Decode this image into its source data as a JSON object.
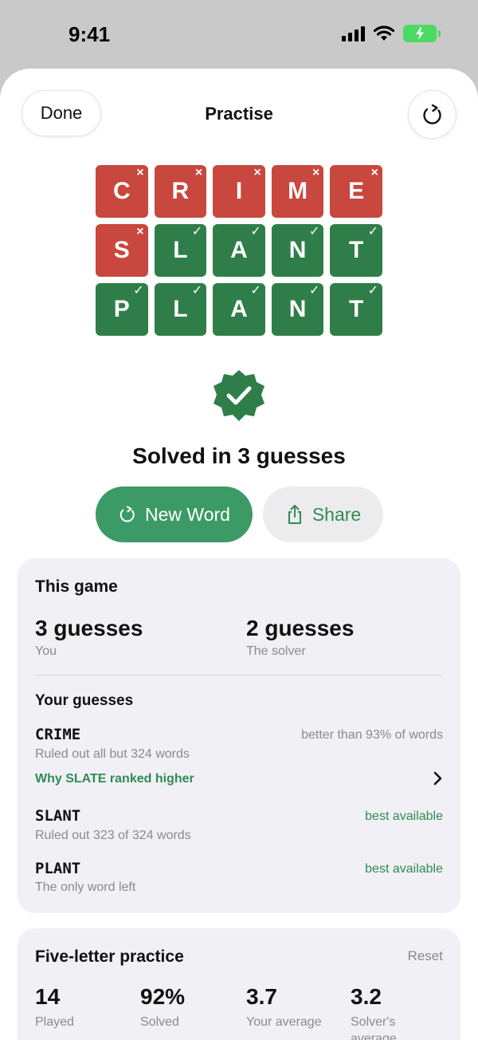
{
  "status_bar": {
    "time": "9:41"
  },
  "nav": {
    "done_label": "Done",
    "title": "Practise",
    "refresh_icon": "refresh-icon"
  },
  "colors": {
    "correct": "#2f7e49",
    "wrong": "#c8473f",
    "accent": "#3b9a66",
    "card_bg": "#f1f1f5"
  },
  "grid": [
    [
      {
        "letter": "C",
        "state": "wrong",
        "mark": "×"
      },
      {
        "letter": "R",
        "state": "wrong",
        "mark": "×"
      },
      {
        "letter": "I",
        "state": "wrong",
        "mark": "×"
      },
      {
        "letter": "M",
        "state": "wrong",
        "mark": "×"
      },
      {
        "letter": "E",
        "state": "wrong",
        "mark": "×"
      }
    ],
    [
      {
        "letter": "S",
        "state": "wrong",
        "mark": "×"
      },
      {
        "letter": "L",
        "state": "correct",
        "mark": "✓"
      },
      {
        "letter": "A",
        "state": "correct",
        "mark": "✓"
      },
      {
        "letter": "N",
        "state": "correct",
        "mark": "✓"
      },
      {
        "letter": "T",
        "state": "correct",
        "mark": "✓"
      }
    ],
    [
      {
        "letter": "P",
        "state": "correct",
        "mark": "✓"
      },
      {
        "letter": "L",
        "state": "correct",
        "mark": "✓"
      },
      {
        "letter": "A",
        "state": "correct",
        "mark": "✓"
      },
      {
        "letter": "N",
        "state": "correct",
        "mark": "✓"
      },
      {
        "letter": "T",
        "state": "correct",
        "mark": "✓"
      }
    ]
  ],
  "result": {
    "title": "Solved in 3 guesses"
  },
  "actions": {
    "new_word_label": "New Word",
    "share_label": "Share"
  },
  "this_game": {
    "heading": "This game",
    "you_value": "3 guesses",
    "you_label": "You",
    "solver_value": "2 guesses",
    "solver_label": "The solver"
  },
  "your_guesses": {
    "heading": "Your guesses",
    "items": [
      {
        "word": "CRIME",
        "detail": "Ruled out all but 324 words",
        "note": "better than 93% of words"
      },
      {
        "word": "SLANT",
        "detail": "Ruled out 323 of 324 words",
        "note": "best available"
      },
      {
        "word": "PLANT",
        "detail": "The only word left",
        "note": "best available"
      }
    ],
    "why_link": "Why SLATE ranked higher"
  },
  "practice": {
    "heading": "Five-letter practice",
    "reset_label": "Reset",
    "stats": [
      {
        "value": "14",
        "label": "Played"
      },
      {
        "value": "92%",
        "label": "Solved"
      },
      {
        "value": "3.7",
        "label": "Your average"
      },
      {
        "value": "3.2",
        "label": "Solver's average"
      }
    ]
  }
}
